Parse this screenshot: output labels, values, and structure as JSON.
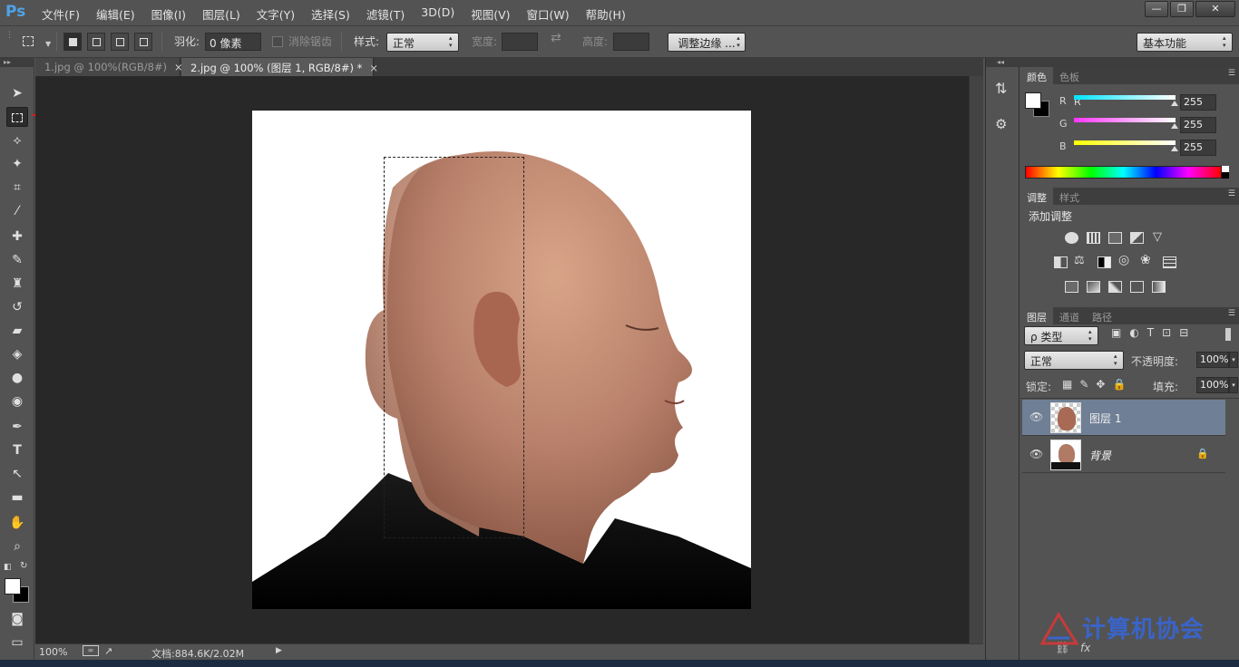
{
  "app": {
    "logo": "Ps"
  },
  "menu": [
    "文件(F)",
    "编辑(E)",
    "图像(I)",
    "图层(L)",
    "文字(Y)",
    "选择(S)",
    "滤镜(T)",
    "3D(D)",
    "视图(V)",
    "窗口(W)",
    "帮助(H)"
  ],
  "window_controls": {
    "minimize": "—",
    "maximize": "❐",
    "close": "✕"
  },
  "options": {
    "feather_label": "羽化:",
    "feather_value": "0 像素",
    "antialias_label": "消除锯齿",
    "style_label": "样式:",
    "style_value": "正常",
    "width_label": "宽度:",
    "height_label": "高度:",
    "refine_edge_button": "调整边缘 ...",
    "workspace": "基本功能"
  },
  "tabs": [
    {
      "label": "1.jpg @ 100%(RGB/8#)",
      "close": "×"
    },
    {
      "label": "2.jpg @ 100% (图层 1, RGB/8#) *",
      "close": "×"
    }
  ],
  "status": {
    "zoom": "100%",
    "doc_info": "文档:884.6K/2.02M",
    "arrow": "▶"
  },
  "tools": {
    "move": "move-tool",
    "marquee": "rect-marquee-tool",
    "lasso": "polygon-lasso-tool",
    "wand": "magic-wand-tool",
    "crop": "crop-tool",
    "eyedropper": "eyedropper-tool",
    "heal": "healing-brush-tool",
    "brush": "brush-tool",
    "stamp": "clone-stamp-tool",
    "history": "history-brush-tool",
    "eraser": "eraser-tool",
    "bucket": "paint-bucket-tool",
    "blur": "blur-tool",
    "dodge": "dodge-tool",
    "pen": "pen-tool",
    "type": "T",
    "path_select": "path-selection-tool",
    "rect": "rectangle-tool",
    "hand": "hand-tool",
    "zoom": "zoom-tool",
    "quickmask": "quick-mask-tool",
    "screenmode": "screen-mode-tool"
  },
  "color_panel": {
    "tabs": [
      "颜色",
      "色板"
    ],
    "channels": [
      {
        "label": "R",
        "value": "255",
        "color": "#00e5ff"
      },
      {
        "label": "G",
        "value": "255",
        "color": "#ff36ff"
      },
      {
        "label": "B",
        "value": "255",
        "color": "#ffff00"
      }
    ]
  },
  "adjust_panel": {
    "tabs": [
      "调整",
      "样式"
    ],
    "title": "添加调整"
  },
  "layers_panel": {
    "tabs": [
      "图层",
      "通道",
      "路径"
    ],
    "filter": "ρ 类型",
    "blend_mode": "正常",
    "opacity_label": "不透明度:",
    "opacity_value": "100%",
    "lock_label": "锁定:",
    "fill_label": "填充:",
    "fill_value": "100%",
    "layers": [
      {
        "name": "图层 1",
        "selected": true
      },
      {
        "name": "背景",
        "selected": false
      }
    ],
    "bottom_icons": [
      "link-icon",
      "fx-icon"
    ]
  },
  "watermark": "计算机协会",
  "colors": {
    "accent_selected_layer": "#6f7f95",
    "canvas_bg": "#282828",
    "panel_bg": "#535353"
  }
}
